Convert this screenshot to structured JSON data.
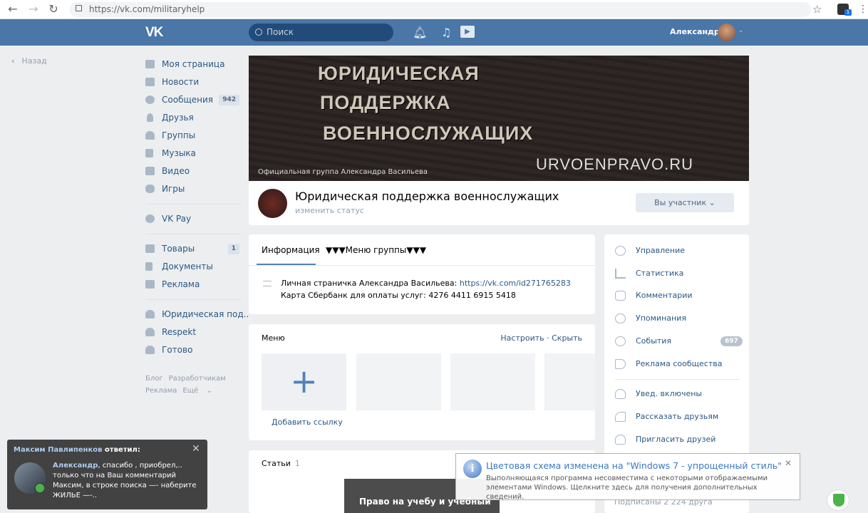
{
  "browser": {
    "url": "https://vk.com/militaryhelp"
  },
  "header": {
    "logo": "VK",
    "search_placeholder": "Поиск",
    "user_name": "Александр"
  },
  "back_label": "Назад",
  "sidebar": {
    "items": [
      {
        "label": "Моя страница"
      },
      {
        "label": "Новости"
      },
      {
        "label": "Сообщения",
        "badge": "942"
      },
      {
        "label": "Друзья"
      },
      {
        "label": "Группы"
      },
      {
        "label": "Музыка"
      },
      {
        "label": "Видео"
      },
      {
        "label": "Игры"
      }
    ],
    "vkpay": "VK Pay",
    "items2": [
      {
        "label": "Товары",
        "badge": "1"
      },
      {
        "label": "Документы"
      },
      {
        "label": "Реклама"
      }
    ],
    "groups": [
      {
        "label": "Юридическая под.."
      },
      {
        "label": "Respekt"
      },
      {
        "label": "Готово"
      }
    ],
    "footer": {
      "blog": "Блог",
      "dev": "Разработчикам",
      "ads": "Реклама",
      "more": "Ещё"
    }
  },
  "cover": {
    "line1": "ЮРИДИЧЕСКАЯ",
    "line2": "ПОДДЕРЖКА",
    "line3": "ВОЕННОСЛУЖАЩИХ",
    "site": "URVOENPRAVO.RU",
    "caption": "Официальная группа Александра Васильева"
  },
  "group": {
    "name": "Юридическая поддержка военнослужащих",
    "status": "изменить статус",
    "member_button": "Вы участник"
  },
  "tabs": {
    "info": "Информация",
    "menu": "▼▼▼Меню группы▼▼▼"
  },
  "info": {
    "personal_prefix": "Личная страничка Александра Васильева: ",
    "personal_link": "https://vk.com/id271765283",
    "card": "Карта Сбербанк для оплаты услуг: 4276 4411 6915 5418"
  },
  "menu_block": {
    "title": "Меню",
    "actions": "Настроить · Скрыть",
    "add_link": "Добавить ссылку"
  },
  "right_menu": {
    "items": [
      {
        "label": "Управление"
      },
      {
        "label": "Статистика"
      },
      {
        "label": "Комментарии"
      },
      {
        "label": "Упоминания"
      },
      {
        "label": "События",
        "badge": "697"
      },
      {
        "label": "Реклама сообщества"
      }
    ],
    "items2": [
      {
        "label": "Увед. включены"
      },
      {
        "label": "Рассказать друзьям"
      },
      {
        "label": "Пригласить друзей"
      }
    ],
    "subscribers": "Подписаны 2 224 друга"
  },
  "articles": {
    "title": "Статьи",
    "count": "1",
    "card_title": "Право на учебу и учебный"
  },
  "toast": {
    "author": "Максим Павлипенков",
    "action": " ответил:",
    "reply_author": "Александр",
    "text": ", спасибо , приобрел,.. только что на Ваш комментарий Максим, в строке поиска —- наберите ЖИЛЬЕ —-.."
  },
  "win_balloon": {
    "title": "Цветовая схема изменена на \"Windows 7 - упрощенный стиль\"",
    "body": "Выполняющаяся программа несовместима с некоторыми отображаемыми элементами Windows. Щелкните здесь для получения дополнительных сведений."
  }
}
